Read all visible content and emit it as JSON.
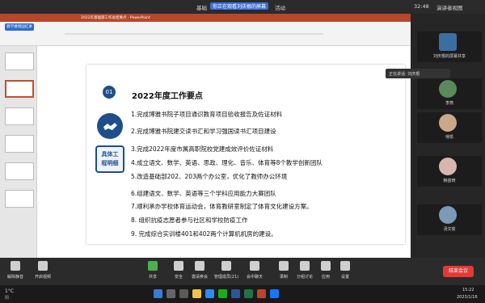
{
  "top_bar": {
    "left_label": "基础",
    "viewing_text": "你正在观看刘庆根的屏幕",
    "activity_label": "活动",
    "time": "32:48",
    "view_label": "演讲者视图"
  },
  "ppt": {
    "title_bar": "2022年基础部工作总结要点 - PowerPoint",
    "sidebar_label": "教学楼周国红讲"
  },
  "slide": {
    "number": "01",
    "title": "2022年度工作要点",
    "team_label": "具体工\n程明细",
    "items": [
      "1.完成博雅书院子项目通识教育项目验收报告及佐证材料",
      "2.完成博雅书院建交读书汇和学习强国读书汇项目建设",
      "3.完成2022年度市属高职院校党建成效评价佐证材料",
      "4.成立语文、数学、英语、思政、理化、音乐、体育等8个教学创新团队",
      "5.改造基础部202、203两个办公室，优化了教师办公环境",
      "6.组建语文、数学、英语等三个学科应用能力大赛团队",
      "7.顺利承办学校体育运动会，体育教研室制定了体育文化建设方案。",
      "8. 组织抗疫志愿者参与社区和学校防疫工作",
      "9. 完成综合实训楼401和402两个计算机机房的建设。"
    ]
  },
  "right_panel": {
    "speaking_label": "正在讲话: 刘庆根",
    "participants": [
      {
        "name": "刘庆根的屏幕共享"
      },
      {
        "name": "李燕"
      },
      {
        "name": "侍凯"
      },
      {
        "name": "韩苗琦"
      },
      {
        "name": "汤文俊"
      }
    ]
  },
  "toolbar": {
    "left_buttons": [
      "解除静音",
      "开启视频"
    ],
    "buttons": [
      "共享",
      "安全",
      "邀请参会",
      "管理成员(21)",
      "会中聊天",
      "录制",
      "分组讨论",
      "应用",
      "设置"
    ],
    "end_label": "结束会议"
  },
  "taskbar": {
    "weather": "1°C",
    "weather_desc": "阴",
    "time": "15:22",
    "date": "2023/1/16"
  },
  "colors": {
    "accent_blue": "#1e4f8a",
    "ppt_red": "#b7472a",
    "end_red": "#e53935"
  }
}
